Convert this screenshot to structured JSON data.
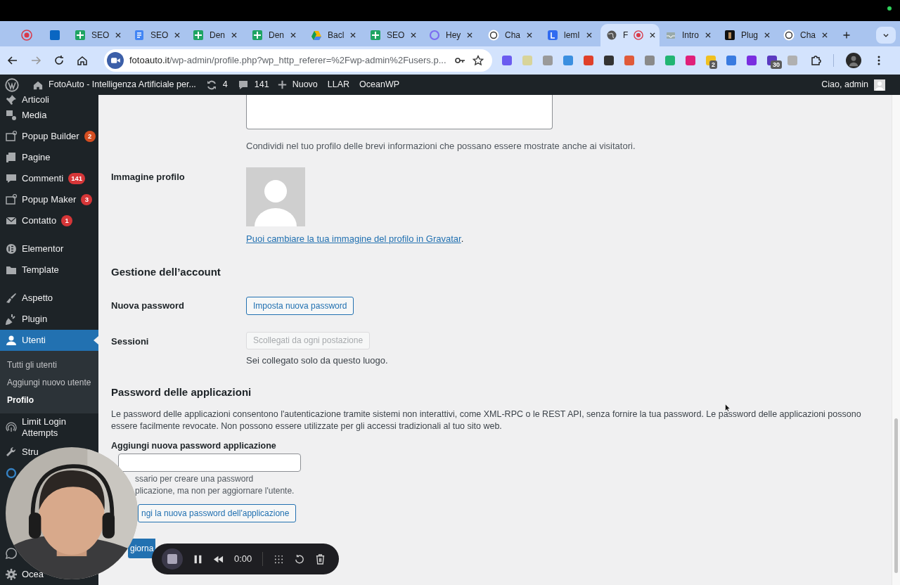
{
  "browser": {
    "tabs": [
      {
        "kind": "record",
        "selected": false,
        "recording": false
      },
      {
        "kind": "linkedin",
        "selected": false,
        "recording": false
      },
      {
        "kind": "sheets",
        "label": "SEO",
        "selected": false,
        "recording": false
      },
      {
        "kind": "docs",
        "label": "SEO",
        "selected": false,
        "recording": false
      },
      {
        "kind": "sheets",
        "label": "Den",
        "selected": false,
        "recording": false
      },
      {
        "kind": "sheets",
        "label": "Den",
        "selected": false,
        "recording": false
      },
      {
        "kind": "drive",
        "label": "Bacl",
        "selected": false,
        "recording": false
      },
      {
        "kind": "sheets",
        "label": "SEO",
        "selected": false,
        "recording": false
      },
      {
        "kind": "ring",
        "label": "Hey",
        "selected": false,
        "recording": false
      },
      {
        "kind": "chat",
        "label": "Cha",
        "selected": false,
        "recording": false
      },
      {
        "kind": "lemlist",
        "label": "lemI",
        "selected": false,
        "recording": false
      },
      {
        "kind": "globe",
        "label": "F",
        "selected": true,
        "recording": true
      },
      {
        "kind": "tray",
        "label": "Intro",
        "selected": false,
        "recording": false
      },
      {
        "kind": "dark",
        "label": "Plug",
        "selected": false,
        "recording": false
      },
      {
        "kind": "chat",
        "label": "Cha",
        "selected": false,
        "recording": false
      }
    ],
    "url_host": "fotoauto.it",
    "url_path": "/wp-admin/profile.php?wp_http_referer=%2Fwp-admin%2Fusers.p...",
    "extensions": [
      {
        "color": "#6b5cf0"
      },
      {
        "color": "#d8d49a"
      },
      {
        "color": "#9a9a9a"
      },
      {
        "color": "#3b8fe0"
      },
      {
        "color": "#e0402a"
      },
      {
        "color": "#333333"
      },
      {
        "color": "#e05a3a"
      },
      {
        "color": "#8a8a8a"
      },
      {
        "color": "#22b573"
      },
      {
        "color": "#e0207a"
      },
      {
        "color": "#f0c020",
        "badge": "2"
      },
      {
        "color": "#3a7be0"
      },
      {
        "color": "#7a2ee0"
      },
      {
        "color": "#5a3ac0",
        "badge": "30"
      },
      {
        "color": "#b0b0b0"
      }
    ]
  },
  "admin_bar": {
    "site": "FotoAuto - Intelligenza Artificiale per...",
    "updates": "4",
    "comments": "141",
    "new": "Nuovo",
    "items": [
      "LLAR",
      "OceanWP"
    ],
    "greeting": "Ciao, admin"
  },
  "sidebar": {
    "groups": [
      [
        {
          "kind": "pin",
          "label": "Articoli",
          "selected": false
        },
        {
          "kind": "media",
          "label": "Media",
          "selected": false
        },
        {
          "kind": "popup",
          "label": "Popup Builder",
          "badge": "2",
          "color": "#d54e21",
          "selected": false
        },
        {
          "kind": "pages",
          "label": "Pagine",
          "selected": false
        },
        {
          "kind": "comment",
          "label": "Commenti",
          "badge": "141",
          "color": "#d63638",
          "selected": false
        },
        {
          "kind": "popup",
          "label": "Popup Maker",
          "badge": "3",
          "color": "#d63638",
          "selected": false
        },
        {
          "kind": "mail",
          "label": "Contatto",
          "badge": "1",
          "color": "#d63638",
          "selected": false
        }
      ],
      [
        {
          "kind": "elementor",
          "label": "Elementor",
          "selected": false
        },
        {
          "kind": "folder",
          "label": "Template",
          "selected": false
        }
      ],
      [
        {
          "kind": "brush",
          "label": "Aspetto",
          "selected": false
        },
        {
          "kind": "plug",
          "label": "Plugin",
          "selected": false
        },
        {
          "kind": "user",
          "label": "Utenti",
          "selected": true,
          "children": [
            {
              "label": "Tutti gli utenti",
              "selected": false
            },
            {
              "label": "Aggiungi nuovo utente",
              "selected": false
            },
            {
              "label": "Profilo",
              "selected": true
            }
          ]
        },
        {
          "kind": "shield",
          "label": "Limit Login Attempts",
          "selected": false
        },
        {
          "kind": "wrench",
          "label": "Stru",
          "selected": false
        },
        {
          "kind": "ring",
          "selected": false
        }
      ],
      [
        {
          "kind": "whatsapp",
          "selected": false
        },
        {
          "kind": "gear",
          "label": "Ocea",
          "selected": false
        }
      ]
    ]
  },
  "profile": {
    "bio_help": "Condividi nel tuo profilo delle brevi informazioni che possano essere mostrate anche ai visitatori.",
    "avatar_label": "Immagine profilo",
    "gravatar_link": "Puoi cambiare la tua immagine del profilo in Gravatar",
    "gravatar_after": ".",
    "account_heading": "Gestione dell’account",
    "password_label": "Nuova password",
    "password_button": "Imposta nuova password",
    "sessions_label": "Sessioni",
    "sessions_button": {
      "label": "Scollegati da ogni postazione",
      "disabled": true
    },
    "sessions_help": "Sei collegato solo da questo luogo.",
    "app_heading": "Password delle applicazioni",
    "app_description": "Le password delle applicazioni consentono l'autenticazione tramite sistemi non interattivi, come XML-RPC o le REST API, senza fornire la tua password. Le password delle applicazioni possono essere facilmente revocate. Non possono essere utilizzate per gli accessi tradizionali al tuo sito web.",
    "app_field_label": "Aggiungi nuova password applicazione",
    "app_help": [
      "ssario per creare una password",
      "plicazione, ma non per aggiornare l'utente."
    ],
    "app_button": "ngi la nuova password dell'applicazione",
    "submit_button": "giorna"
  },
  "recorder": {
    "time": "0:00"
  }
}
